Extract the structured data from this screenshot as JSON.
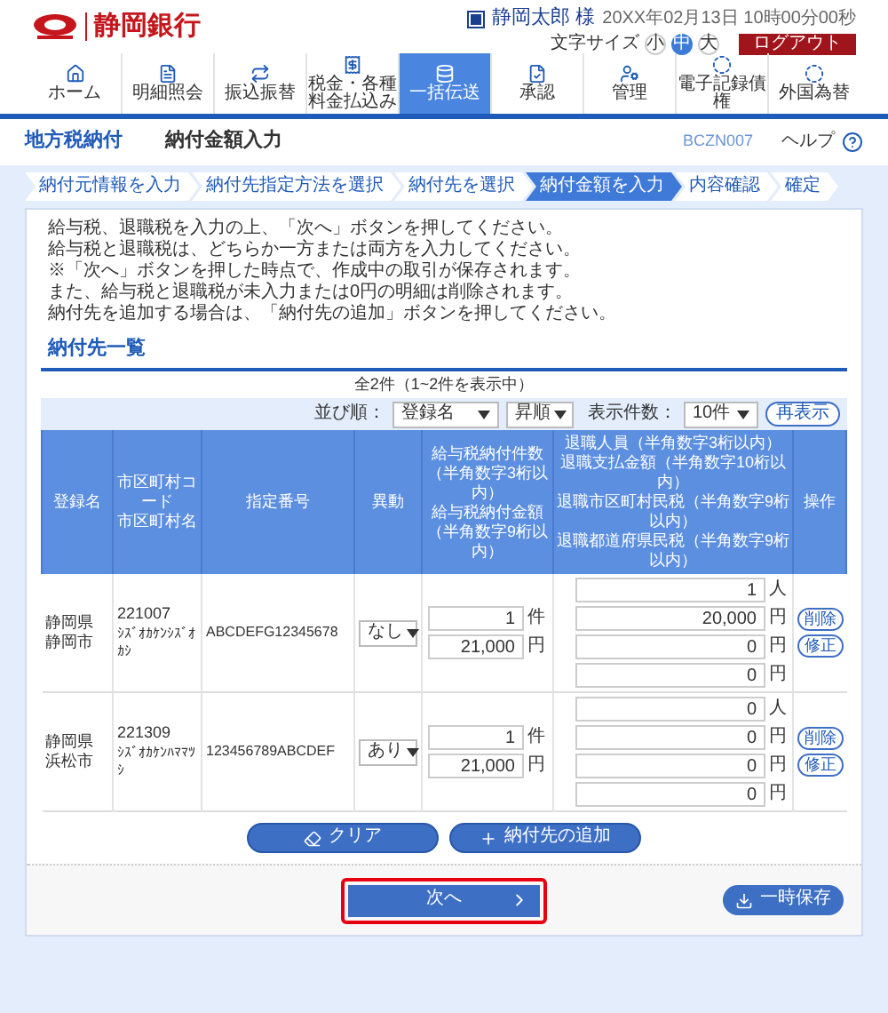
{
  "header": {
    "bank_name": "静岡銀行",
    "user_name": "静岡太郎 様",
    "datetime": "20XX年02月13日 10時00分00秒",
    "font_size_label": "文字サイズ",
    "font_sizes": [
      {
        "label": "小",
        "selected": false
      },
      {
        "label": "中",
        "selected": true
      },
      {
        "label": "大",
        "selected": false
      }
    ],
    "logout": "ログアウト"
  },
  "nav": [
    {
      "label": "ホーム",
      "selected": false
    },
    {
      "label": "明細照会",
      "selected": false
    },
    {
      "label": "振込振替",
      "selected": false
    },
    {
      "label": "税金・各種料金払込み",
      "selected": false
    },
    {
      "label": "一括伝送",
      "selected": true
    },
    {
      "label": "承認",
      "selected": false
    },
    {
      "label": "管理",
      "selected": false
    },
    {
      "label": "電子記録債権",
      "selected": false
    },
    {
      "label": "外国為替",
      "selected": false
    }
  ],
  "page": {
    "category": "地方税納付",
    "title": "納付金額入力",
    "screen_id": "BCZN007",
    "help": "ヘルプ"
  },
  "steps": [
    {
      "label": "納付元情報を入力",
      "selected": false
    },
    {
      "label": "納付先指定方法を選択",
      "selected": false
    },
    {
      "label": "納付先を選択",
      "selected": false
    },
    {
      "label": "納付金額を入力",
      "selected": true
    },
    {
      "label": "内容確認",
      "selected": false
    },
    {
      "label": "確定",
      "selected": false
    }
  ],
  "instructions": [
    "給与税、退職税を入力の上、「次へ」ボタンを押してください。",
    "給与税と退職税は、どちらか一方または両方を入力してください。",
    "※「次へ」ボタンを押した時点で、作成中の取引が保存されます。",
    "また、給与税と退職税が未入力または0円の明細は削除されます。",
    "納付先を追加する場合は、「納付先の追加」ボタンを押してください。"
  ],
  "section_title": "納付先一覧",
  "count": "全2件（1~2件を表示中）",
  "sort": {
    "label": "並び順：",
    "field": "登録名",
    "order": "昇順",
    "per_page_label": "表示件数：",
    "per_page": "10件",
    "refresh": "再表示"
  },
  "table": {
    "columns": [
      [
        "登録名"
      ],
      [
        "市区町村コード",
        "市区町村名"
      ],
      [
        "指定番号"
      ],
      [
        "異動"
      ],
      [
        "給与税納付件数",
        "（半角数字3桁以内）",
        "給与税納付金額",
        "（半角数字9桁以内）"
      ],
      [
        "退職人員（半角数字3桁以内）",
        "退職支払金額（半角数字10桁以内）",
        "退職市区町村民税（半角数字9桁以内）",
        "退職都道府県民税（半角数字9桁以内）"
      ],
      [
        "操作"
      ]
    ],
    "rows": [
      {
        "name": "静岡県静岡市",
        "code": "221007",
        "city_kana": "ｼｽﾞｵｶｹﾝｼｽﾞｵｶｼ",
        "number": "ABCDEFG12345678",
        "change": "なし",
        "salary": [
          {
            "value": "1",
            "unit": "件"
          },
          {
            "value": "21,000",
            "unit": "円"
          }
        ],
        "retirement": [
          {
            "value": "1",
            "unit": "人"
          },
          {
            "value": "20,000",
            "unit": "円"
          },
          {
            "value": "0",
            "unit": "円"
          },
          {
            "value": "0",
            "unit": "円"
          }
        ],
        "actions": [
          "削除",
          "修正"
        ]
      },
      {
        "name": "静岡県浜松市",
        "code": "221309",
        "city_kana": "ｼｽﾞｵｶｹﾝﾊﾏﾏﾂｼ",
        "number": "123456789ABCDEF",
        "change": "あり",
        "salary": [
          {
            "value": "1",
            "unit": "件"
          },
          {
            "value": "21,000",
            "unit": "円"
          }
        ],
        "retirement": [
          {
            "value": "0",
            "unit": "人"
          },
          {
            "value": "0",
            "unit": "円"
          },
          {
            "value": "0",
            "unit": "円"
          },
          {
            "value": "0",
            "unit": "円"
          }
        ],
        "actions": [
          "削除",
          "修正"
        ]
      }
    ]
  },
  "buttons": [
    "クリア",
    "納付先の追加"
  ],
  "footer": {
    "next": {
      "label": "次へ",
      "highlighted": true
    },
    "save": "一時保存"
  }
}
